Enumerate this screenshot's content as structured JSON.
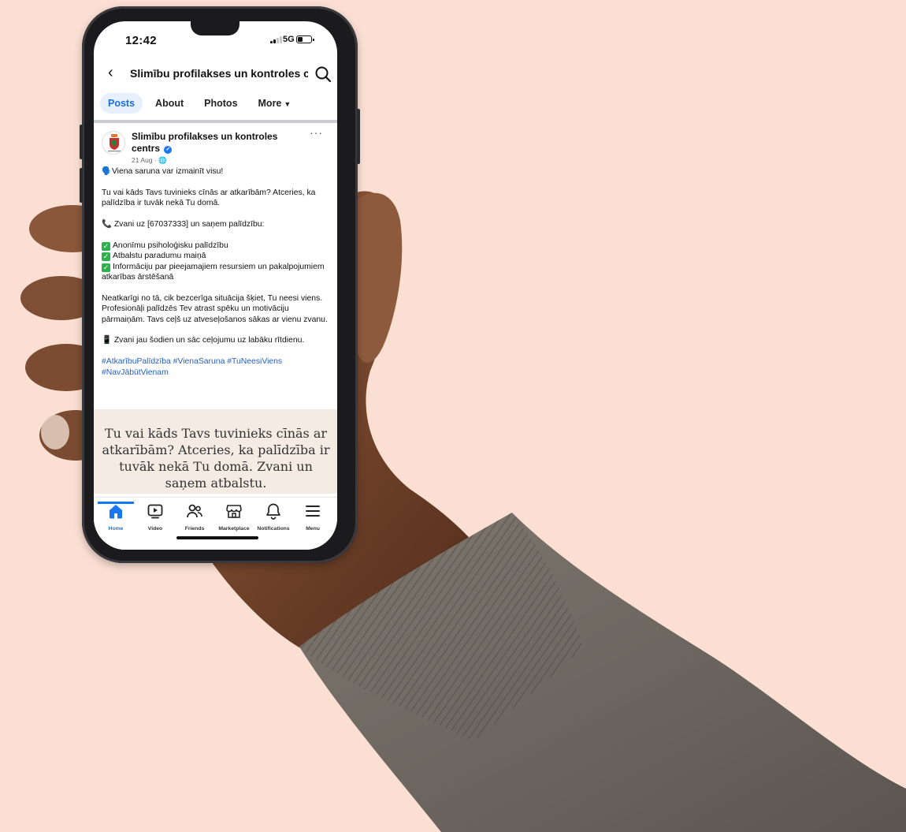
{
  "status_bar": {
    "time": "12:42",
    "network": "5G"
  },
  "header": {
    "title": "Slimību profilakses un kontroles c..."
  },
  "tabs": [
    {
      "label": "Posts"
    },
    {
      "label": "About"
    },
    {
      "label": "Photos"
    },
    {
      "label": "More"
    }
  ],
  "post": {
    "author": "Slimību profilakses un kontroles centrs",
    "date": "21 Aug",
    "lines": {
      "p1": "🗣️Viena saruna var izmainīt visu!",
      "p2": "Tu vai kāds Tavs tuvinieks cīnās ar atkarībām? Atceries, ka palīdzība ir tuvāk nekā Tu domā.",
      "p3": "📞 Zvani uz [67037333] un saņem palīdzību:",
      "c1": "Anonīmu psiholoģisku palīdzību",
      "c2": "Atbalstu paradumu maiņā",
      "c3": "Informāciju par pieejamajiem resursiem un pakalpojumiem atkarības ārstēšanā",
      "p4": "Neatkarīgi no tā, cik bezcerīga situācija šķiet, Tu neesi viens. Profesionāļi palīdzēs Tev atrast spēku un motivāciju pārmaiņām. Tavs ceļš uz atveseļošanos sākas ar vienu zvanu.",
      "p5": "📱 Zvani jau šodien un sāc ceļojumu uz labāku rītdienu.",
      "hashtags": "#AtkarībuPalīdzība #VienaSaruna #TuNeesiViens #NavJābūtVienam"
    },
    "image_text": "Tu vai kāds Tavs tuvinieks cīnās ar atkarībām? Atceries, ka palīdzība ir tuvāk nekā Tu domā. Zvani un saņem atbalstu."
  },
  "bottom_nav": [
    {
      "label": "Home",
      "icon": "home-icon"
    },
    {
      "label": "Video",
      "icon": "video-icon"
    },
    {
      "label": "Friends",
      "icon": "friends-icon"
    },
    {
      "label": "Marketplace",
      "icon": "marketplace-icon"
    },
    {
      "label": "Notifications",
      "icon": "bell-icon"
    },
    {
      "label": "Menu",
      "icon": "menu-icon"
    }
  ],
  "colors": {
    "background": "#fbdfd3",
    "accent": "#1877f2",
    "hashtag": "#2560c4",
    "sleeve": "#6f6a62",
    "skin": "#8a5a3f"
  }
}
